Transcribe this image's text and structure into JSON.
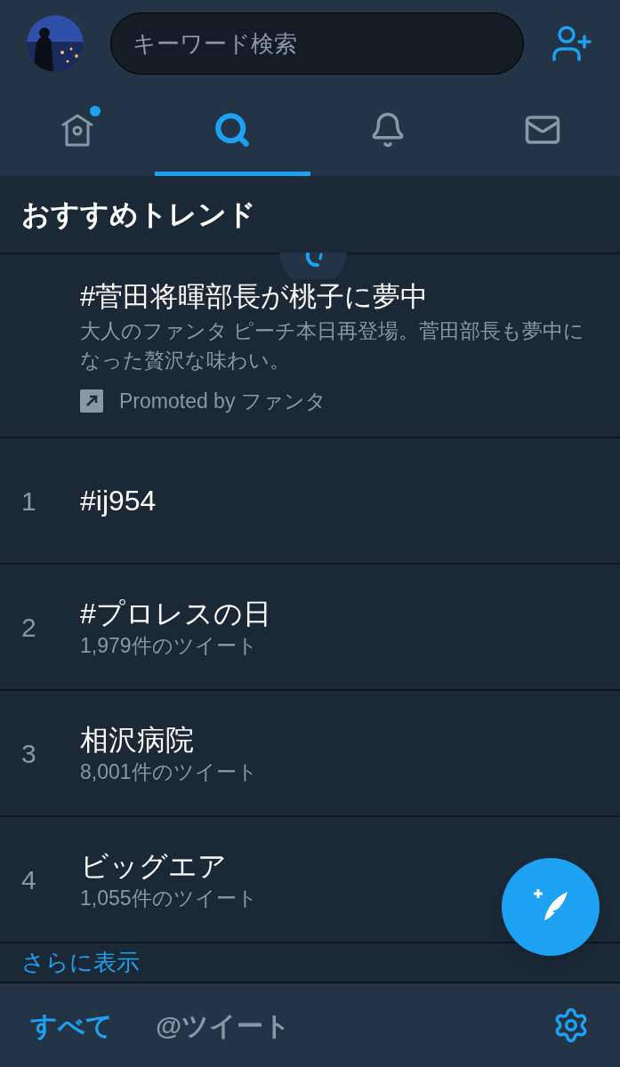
{
  "header": {
    "search": {
      "placeholder": "キーワード検索"
    }
  },
  "nav_tabs": [
    {
      "kind": "home",
      "selected": false,
      "badge": true
    },
    {
      "kind": "search",
      "selected": true,
      "badge": false
    },
    {
      "kind": "notifications",
      "selected": false,
      "badge": false
    },
    {
      "kind": "messages",
      "selected": false,
      "badge": false
    }
  ],
  "section_title": "おすすめトレンド",
  "promoted": {
    "title": "#菅田将暉部長が桃子に夢中",
    "description": "大人のファンタ ピーチ本日再登場。菅田部長も夢中になった贅沢な味わい。",
    "promoted_by": "Promoted by ファンタ"
  },
  "trends": [
    {
      "rank": "1",
      "name": "#ij954"
    },
    {
      "rank": "2",
      "name": "#プロレスの日",
      "count": "1,979件のツイート"
    },
    {
      "rank": "3",
      "name": "相沢病院",
      "count": "8,001件のツイート"
    },
    {
      "rank": "4",
      "name": "ビッグエア",
      "count": "1,055件のツイート"
    }
  ],
  "show_more": "さらに表示",
  "bottom_tabs": [
    {
      "label": "すべて",
      "selected": true
    },
    {
      "label": "@ツイート",
      "selected": false
    }
  ]
}
